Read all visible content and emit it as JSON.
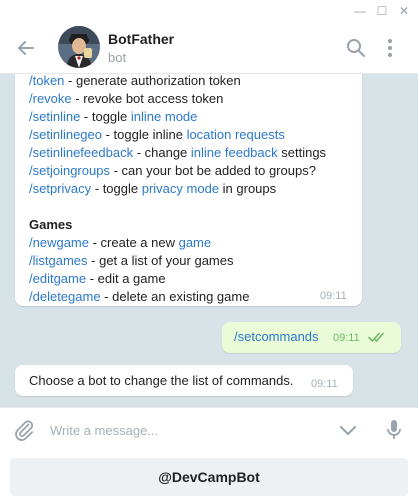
{
  "window": {
    "minimize_glyph": "—",
    "maximize_glyph": "☐",
    "close_glyph": "✕"
  },
  "header": {
    "title": "BotFather",
    "status": "bot",
    "icons": [
      "back-arrow-icon",
      "search-icon",
      "more-vertical-icon"
    ]
  },
  "messages": {
    "bot_help": {
      "lines": [
        [
          {
            "t": "/token",
            "link": true
          },
          {
            "t": " - generate authorization token"
          }
        ],
        [
          {
            "t": "/revoke",
            "link": true
          },
          {
            "t": " - revoke bot access token"
          }
        ],
        [
          {
            "t": "/setinline",
            "link": true
          },
          {
            "t": " - toggle "
          },
          {
            "t": "inline mode",
            "link": true
          }
        ],
        [
          {
            "t": "/setinlinegeo",
            "link": true
          },
          {
            "t": " - toggle inline "
          },
          {
            "t": "location requests",
            "link": true
          }
        ],
        [
          {
            "t": "/setinlinefeedback",
            "link": true
          },
          {
            "t": " - change "
          },
          {
            "t": "inline feedback",
            "link": true
          },
          {
            "t": " settings"
          }
        ],
        [
          {
            "t": "/setjoingroups",
            "link": true
          },
          {
            "t": " - can your bot be added to groups?"
          }
        ],
        [
          {
            "t": "/setprivacy",
            "link": true
          },
          {
            "t": " - toggle "
          },
          {
            "t": "privacy mode",
            "link": true
          },
          {
            "t": " in groups"
          }
        ],
        [],
        [
          {
            "t": "Games",
            "bold": true
          }
        ],
        [
          {
            "t": "/newgame",
            "link": true
          },
          {
            "t": " - create a new "
          },
          {
            "t": "game",
            "link": true
          }
        ],
        [
          {
            "t": "/listgames",
            "link": true
          },
          {
            "t": " - get a list of your games"
          }
        ],
        [
          {
            "t": "/editgame",
            "link": true
          },
          {
            "t": " - edit a game"
          }
        ],
        [
          {
            "t": "/deletegame",
            "link": true
          },
          {
            "t": " - delete an existing game"
          }
        ]
      ],
      "time": "09:11"
    },
    "outgoing": {
      "text": "/setcommands",
      "time": "09:11",
      "status": "read"
    },
    "reply": {
      "text": "Choose a bot to change the list of commands.",
      "time": "09:11"
    }
  },
  "composer": {
    "placeholder": "Write a message...",
    "icons": [
      "attach-icon",
      "chevron-down-icon",
      "microphone-icon"
    ]
  },
  "keyboard": {
    "button_label": "@DevCampBot"
  },
  "colors": {
    "link": "#2c79c9",
    "chat_background": "#d8e3e8",
    "outgoing_bubble": "#eafbd8",
    "read_ticks": "#6fb96a"
  }
}
